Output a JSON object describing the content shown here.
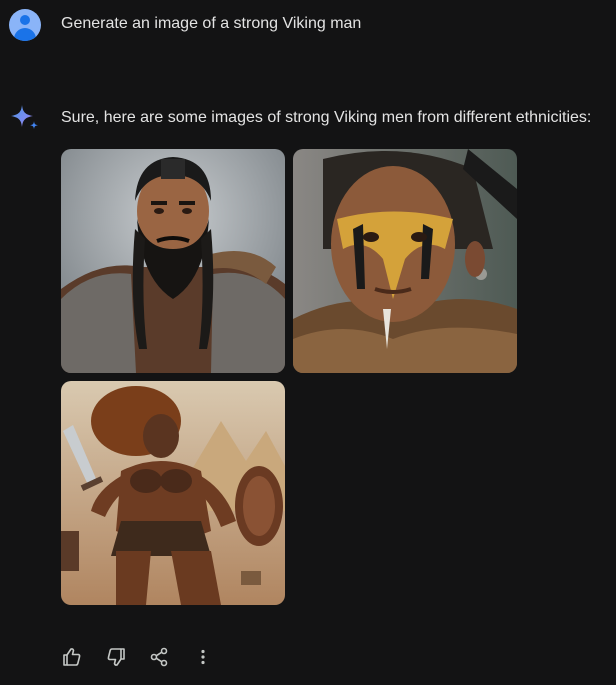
{
  "user": {
    "prompt": "Generate an image of a strong Viking man",
    "avatar_icon": "user-avatar-icon"
  },
  "assistant": {
    "icon": "gemini-sparkle-icon",
    "message": "Sure, here are some images of strong Viking men from different ethnicities:",
    "images": [
      {
        "name": "viking-image-1"
      },
      {
        "name": "viking-image-2"
      },
      {
        "name": "viking-image-3"
      }
    ]
  },
  "actions": [
    {
      "icon": "thumbs-up-icon"
    },
    {
      "icon": "thumbs-down-icon"
    },
    {
      "icon": "share-icon"
    },
    {
      "icon": "more-vert-icon"
    }
  ],
  "colors": {
    "background": "#131314",
    "text": "#e3e3e3",
    "icon": "#c4c7c5",
    "sparkle_blue": "#4285f4"
  }
}
